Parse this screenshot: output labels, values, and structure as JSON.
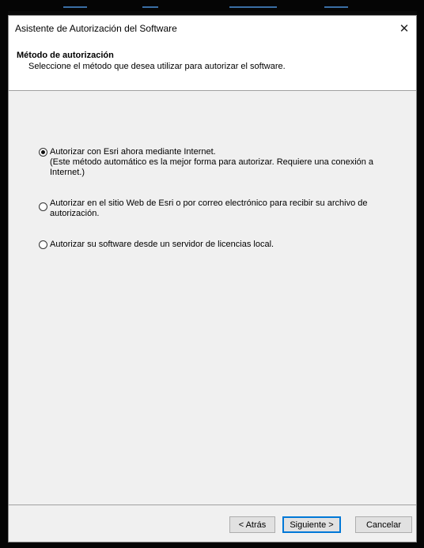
{
  "window": {
    "title": "Asistente de Autorización del Software",
    "close_glyph": "✕"
  },
  "header": {
    "title": "Método de autorización",
    "subtitle": "Seleccione el método que desea utilizar para autorizar el software."
  },
  "options": [
    {
      "selected": true,
      "line1": "Autorizar con Esri ahora mediante Internet.",
      "line2": "(Este método automático es la mejor forma para autorizar. Requiere una conexión a",
      "line3": "Internet.)"
    },
    {
      "selected": false,
      "line1": "Autorizar en el sitio Web de Esri o por correo electrónico para recibir su archivo de",
      "line2": "autorización."
    },
    {
      "selected": false,
      "line1": "Autorizar su software desde un servidor de licencias local."
    }
  ],
  "buttons": {
    "back": "< Atrás",
    "next": "Siguiente >",
    "cancel": "Cancelar"
  }
}
